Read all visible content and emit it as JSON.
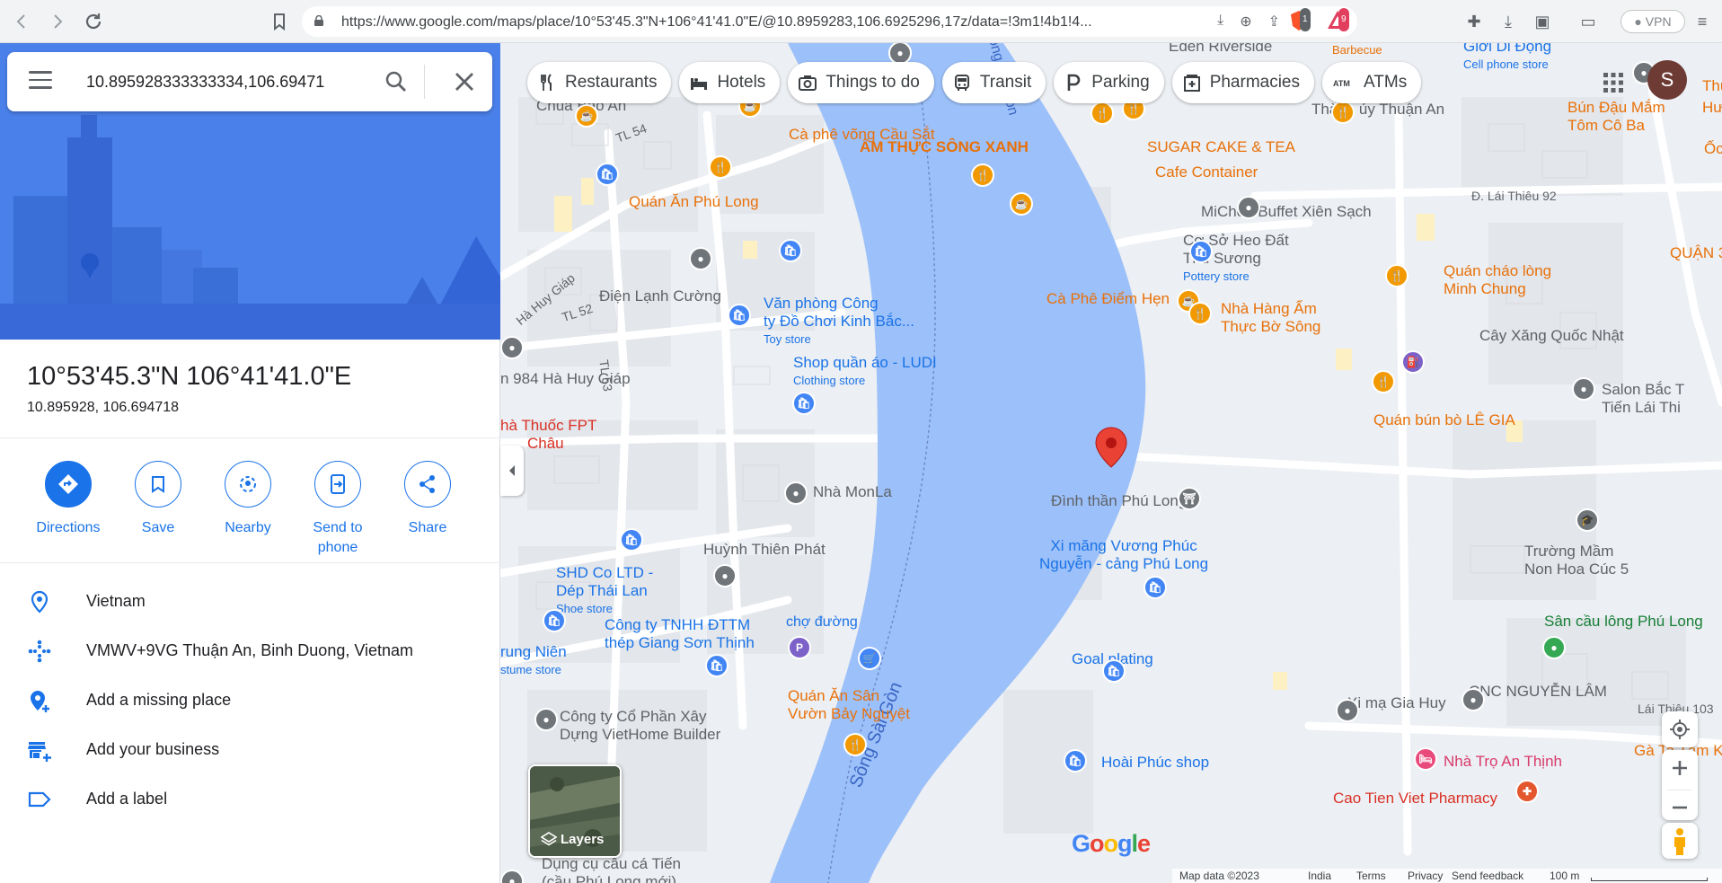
{
  "browser": {
    "url": "https://www.google.com/maps/place/10°53'45.3\"N+106°41'41.0\"E/@10.8959283,106.6925296,17z/data=!3m1!4b1!4...",
    "vpn_label": "VPN",
    "brave_badge": "1",
    "alert_badge": "9"
  },
  "search": {
    "query": "10.895928333333334,106.69471"
  },
  "place": {
    "title": "10°53'45.3\"N 106°41'41.0\"E",
    "decimal": "10.895928, 106.694718"
  },
  "actions": [
    {
      "label": "Directions",
      "icon": "directions-icon"
    },
    {
      "label": "Save",
      "icon": "bookmark-icon"
    },
    {
      "label": "Nearby",
      "icon": "nearby-icon"
    },
    {
      "label": "Send to phone",
      "icon": "send-to-phone-icon"
    },
    {
      "label": "Share",
      "icon": "share-icon"
    }
  ],
  "info_rows": [
    {
      "text": "Vietnam",
      "icon": "location-pin-icon"
    },
    {
      "text": "VMWV+9VG Thuận An, Binh Duong, Vietnam",
      "icon": "plus-code-icon"
    },
    {
      "text": "Add a missing place",
      "icon": "add-place-icon"
    },
    {
      "text": "Add your business",
      "icon": "add-business-icon"
    },
    {
      "text": "Add a label",
      "icon": "label-icon"
    }
  ],
  "chips": [
    {
      "label": "Restaurants",
      "icon": "fork-knife-icon"
    },
    {
      "label": "Hotels",
      "icon": "bed-icon"
    },
    {
      "label": "Things to do",
      "icon": "camera-icon"
    },
    {
      "label": "Transit",
      "icon": "bus-icon"
    },
    {
      "label": "Parking",
      "icon": "parking-icon"
    },
    {
      "label": "Pharmacies",
      "icon": "pharmacy-icon"
    },
    {
      "label": "ATMs",
      "icon": "atm-icon"
    }
  ],
  "avatar_letter": "S",
  "map_labels": {
    "eden": "Eden Riverside",
    "barbecue": "Barbecue",
    "gioi_di_dong": "Giới Di Động",
    "cell_phone_store": "Cell phone store",
    "thu": "Thu",
    "hu": "Hư",
    "chua_bao_an": "Chua Bao An",
    "tl54": "TL 54",
    "thanh_uy": "Thành ủy Thuận An",
    "bun_dau_1": "Bún Đậu Mắm",
    "bun_dau_2": "Tôm Cô Ba",
    "oc": "Ốc",
    "ca_phe_vong": "Cà phê võng Cầu Sắt",
    "song_label_top": "Sông Sài Gòn",
    "am_thuc": "ẨM THỰC SÔNG XANH",
    "sugar": "SUGAR CAKE & TEA",
    "cafe_container": "Cafe Container",
    "quan_an_phu_long": "Quán Ăn Phú Long",
    "michou": "MiChou Buffet Xiên Sạch",
    "lai_thieu_92": "Đ. Lái Thiêu 92",
    "ha_huy_giap_road": "Hà Huy Giáp",
    "co_so_heo_1": "Cơ Sở Heo Đất",
    "co_so_heo_2": "Thủ Sương",
    "pottery": "Pottery store",
    "quan_chao_1": "Quán cháo lòng",
    "quan_chao_2": "Minh Chung",
    "quan3": "QUẬN 3",
    "dien_lanh": "Điện Lạnh Cường",
    "van_phong_1": "Văn phòng Công",
    "van_phong_2": "ty Đồ Chơi Kinh Bắc...",
    "toy_store": "Toy store",
    "ca_phe_diem_hen": "Cà Phê Điểm Hẹn",
    "nha_hang_1": "Nhà Hàng Ẩm",
    "nha_hang_2": "Thực Bờ Sông",
    "cay_xang": "Cây Xăng Quốc Nhật",
    "tl52": "TL 52",
    "shop_ludi": "Shop quần áo - LUDI",
    "clothing": "Clothing store",
    "tl53": "TL 53",
    "ha_huy_giap_984": "n 984 Hà Huy Giáp",
    "salon_1": "Salon Bắc T",
    "salon_2": "Tiến Lái Thi",
    "nha_thuoc_1": "hà Thuốc FPT",
    "nha_thuoc_2": "Châu",
    "quan_bun_bo": "Quán bún bò LÊ GIA",
    "nha_monla": "Nhà MonLa",
    "dinh_than": "Đình thần Phú Long",
    "huynh_thien_phat": "Huỳnh Thiên Phát",
    "xi_mang_1": "Xi măng Vương Phúc",
    "xi_mang_2": "Nguyễn - cảng Phú Long",
    "truong_mam_1": "Trường Mầm",
    "truong_mam_2": "Non Hoa Cúc 5",
    "shd_1": "SHD Co LTD -",
    "shd_2": "Dép Thái Lan",
    "shoe_store": "Shoe store",
    "cong_ty_tnhh_1": "Công ty TNHH ĐTTM",
    "cong_ty_tnhh_2": "thép Giang Sơn Thịnh",
    "cho_duong": "chợ đường",
    "san_cau_long": "Sân cầu lông Phú Long",
    "trung_nien_1": "rung Niên",
    "trung_nien_2": "stume store",
    "goal_plating": "Goal plating",
    "song_sai_gon": "Sông Sài Gòn",
    "quan_an_san_1": "Quán Ăn Sân",
    "quan_an_san_2": "Vườn Bảy Nguyệt",
    "xi_ma_gia_huy": "Xi mạ Gia Huy",
    "cnc": "CNC NGUYỄN LÂM",
    "lai_thieu_103": "Lái Thiêu 103",
    "cong_ty_co_phan_1": "Công ty Cổ Phần Xây",
    "cong_ty_co_phan_2": "Dựng VietHome Builder",
    "hoai_phuc": "Hoài Phúc shop",
    "nha_tro": "Nhà Trọ An Thịnh",
    "ga_ta": "Gà Ta Tâm Ký",
    "cao_tien": "Cao Tien Viet Pharmacy",
    "dung_cu_1": "Dụng cụ câu cá Tiến",
    "dung_cu_2": "(cầu Phú Long mới)"
  },
  "layers_label": "Layers",
  "footer": {
    "map_data": "Map data ©2023",
    "india": "India",
    "terms": "Terms",
    "privacy": "Privacy",
    "send_feedback": "Send feedback",
    "scale": "100 m"
  },
  "google_logo": "Google",
  "colors": {
    "accent": "#1a73e8",
    "river": "#9cc0f9",
    "hero": "#4a7fe8",
    "pin_red": "#ea4335"
  }
}
